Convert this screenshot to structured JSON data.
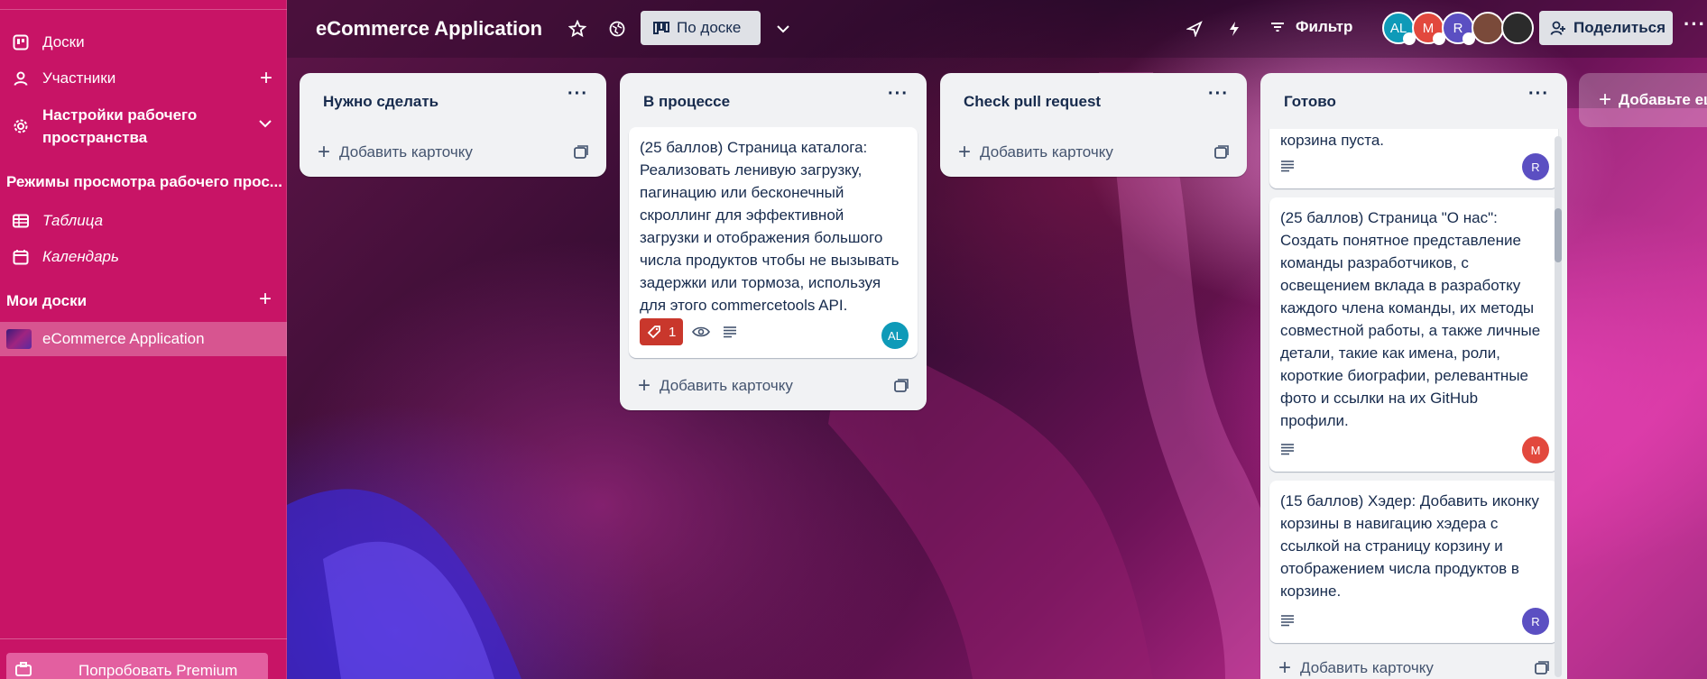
{
  "sidebar": {
    "items": [
      {
        "label": "Доски",
        "icon": "board-icon"
      },
      {
        "label": "Участники",
        "icon": "person-icon"
      },
      {
        "label": "Настройки рабочего пространства",
        "icon": "gear-icon"
      }
    ],
    "views_heading": "Режимы просмотра рабочего прос...",
    "views": [
      {
        "label": "Таблица",
        "icon": "table-icon"
      },
      {
        "label": "Календарь",
        "icon": "calendar-icon"
      }
    ],
    "boards_heading": "Мои доски",
    "boards": [
      {
        "label": "eCommerce Application"
      }
    ],
    "premium_label": "Попробовать Premium"
  },
  "header": {
    "title": "eCommerce Application",
    "view_label": "По доске",
    "filter_label": "Фильтр",
    "share_label": "Поделиться",
    "avatars": [
      {
        "initials": "AL",
        "color": "#0e9ab8"
      },
      {
        "initials": "M",
        "color": "#e2483d"
      },
      {
        "initials": "R",
        "color": "#5b4fc2"
      },
      {
        "initials": "",
        "color": "#7a4a3a"
      },
      {
        "initials": "",
        "color": "#2b2b2b"
      }
    ]
  },
  "lists": [
    {
      "title": "Нужно сделать",
      "add_label": "Добавить карточку"
    },
    {
      "title": "В процессе",
      "add_label": "Добавить карточку",
      "cards": [
        {
          "text": "(25 баллов) Страница каталога: Реализовать ленивую загрузку, пагинацию или бесконечный скроллинг для эффективной загрузки и отображения большого числа продуктов чтобы не вызывать задержки или тормоза, используя для этого commercetools API.",
          "badge_count": "1",
          "avatar": "AL",
          "avatar_color": "#0e9ab8"
        }
      ]
    },
    {
      "title": "Check pull request",
      "add_label": "Добавить карточку"
    },
    {
      "title": "Готово",
      "add_label": "Добавить карточку",
      "cards": [
        {
          "text": "корзина пуста.",
          "avatar": "R",
          "avatar_color": "#5b4fc2"
        },
        {
          "text": "(25 баллов) Страница \"О нас\": Создать понятное представление команды разработчиков, с освещением вклада в разработку каждого члена команды, их методы совместной работы, а также личные детали, такие как имена, роли, короткие биографии, релевантные фото и ссылки на их GitHub профили.",
          "avatar": "M",
          "avatar_color": "#e2483d"
        },
        {
          "text": "(15 баллов) Хэдер: Добавить иконку корзины в навигацию хэдера с ссылкой на страницу корзину и отображением числа продуктов в корзине.",
          "avatar": "R",
          "avatar_color": "#5b4fc2"
        }
      ]
    }
  ],
  "add_list_label": "Добавьте ещё"
}
